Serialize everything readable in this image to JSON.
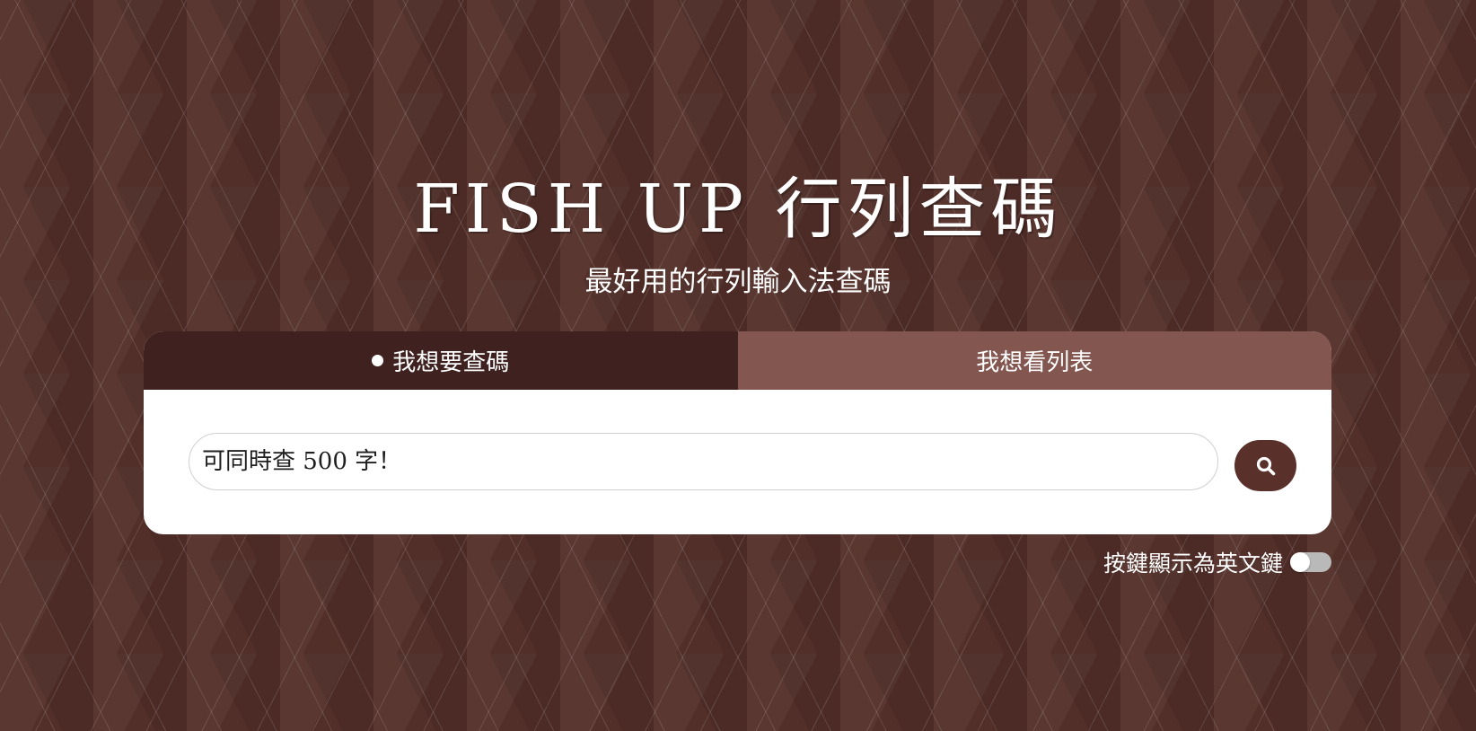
{
  "header": {
    "title": "FISH UP 行列查碼",
    "subtitle": "最好用的行列輸入法查碼"
  },
  "tabs": [
    {
      "label": "我想要查碼",
      "active": true
    },
    {
      "label": "我想看列表",
      "active": false
    }
  ],
  "search": {
    "value": "",
    "placeholder": "可同時查 500 字！",
    "button_icon": "search-icon"
  },
  "options": {
    "english_keys_label": "按鍵顯示為英文鍵",
    "english_keys_enabled": false
  },
  "colors": {
    "background": "#532f29",
    "tab_active": "#3f2220",
    "tab_inactive": "#835650",
    "button": "#5a302b"
  }
}
